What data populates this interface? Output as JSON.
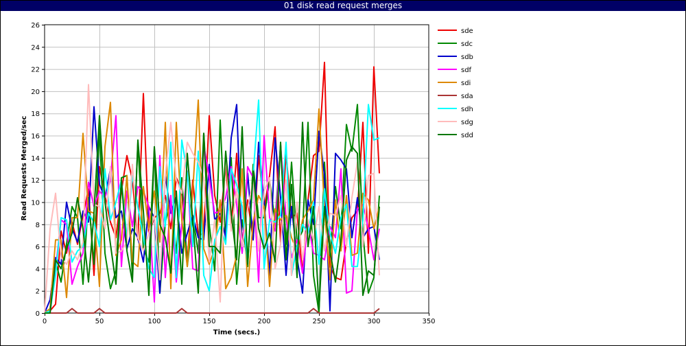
{
  "window": {
    "title": "01 disk read request merges"
  },
  "chart_data": {
    "type": "line",
    "title": "01 disk read request merges",
    "xlabel": "Time (secs.)",
    "ylabel": "Read Requests Merged/sec",
    "xlim": [
      0,
      350
    ],
    "ylim": [
      0,
      26
    ],
    "xticks": [
      0,
      50,
      100,
      150,
      200,
      250,
      300,
      350
    ],
    "yticks": [
      0,
      2,
      4,
      6,
      8,
      10,
      12,
      14,
      16,
      18,
      20,
      22,
      24,
      26
    ],
    "grid": true,
    "legend_position": "right",
    "x": [
      5,
      10,
      15,
      20,
      25,
      30,
      35,
      40,
      45,
      50,
      55,
      60,
      65,
      70,
      75,
      80,
      85,
      90,
      95,
      100,
      105,
      110,
      115,
      120,
      125,
      130,
      135,
      140,
      145,
      150,
      155,
      160,
      165,
      170,
      175,
      180,
      185,
      190,
      195,
      200,
      205,
      210,
      215,
      220,
      225,
      230,
      235,
      240,
      245,
      250,
      255,
      260,
      265,
      270,
      275,
      280,
      285,
      290,
      295,
      300,
      305
    ],
    "series": [
      {
        "name": "sde",
        "color": "#ee0000",
        "values": [
          0.2,
          0.8,
          7.4,
          5.4,
          8.2,
          6.2,
          8.8,
          11.2,
          3.4,
          13.2,
          10.6,
          8.2,
          6.8,
          11.0,
          14.2,
          12.0,
          6.6,
          19.8,
          7.2,
          8.6,
          9.0,
          10.6,
          7.6,
          12.2,
          11.0,
          4.6,
          12.0,
          7.0,
          7.2,
          17.8,
          10.6,
          8.2,
          13.2,
          7.8,
          14.4,
          6.4,
          10.2,
          6.6,
          14.2,
          9.4,
          12.4,
          16.8,
          6.4,
          14.4,
          8.6,
          9.0,
          3.6,
          10.2,
          14.2,
          14.6,
          22.6,
          4.2,
          3.2,
          3.0,
          6.4,
          8.6,
          9.2,
          17.2,
          5.4,
          22.2,
          12.6
        ]
      },
      {
        "name": "sdc",
        "color": "#008800",
        "values": [
          0.4,
          4.6,
          2.8,
          6.2,
          9.6,
          8.6,
          2.6,
          10.4,
          4.4,
          16.6,
          5.4,
          2.2,
          3.8,
          12.2,
          12.4,
          3.4,
          15.4,
          5.8,
          4.6,
          14.8,
          1.8,
          8.2,
          10.2,
          5.4,
          12.2,
          4.2,
          8.8,
          5.4,
          16.2,
          8.0,
          3.8,
          17.4,
          6.4,
          14.0,
          2.6,
          8.4,
          4.2,
          13.4,
          8.6,
          8.6,
          12.0,
          8.2,
          15.2,
          6.2,
          13.6,
          6.4,
          7.4,
          17.2,
          3.4,
          0.0,
          13.6,
          5.2,
          11.4,
          7.6,
          17.0,
          14.6,
          18.8,
          7.2,
          1.8,
          3.2,
          10.6
        ]
      },
      {
        "name": "sdb",
        "color": "#0000cc",
        "values": [
          1.2,
          5.0,
          4.4,
          10.0,
          7.6,
          6.4,
          9.2,
          8.2,
          18.6,
          11.6,
          10.4,
          13.0,
          8.6,
          9.2,
          5.8,
          7.6,
          6.8,
          4.6,
          9.6,
          8.6,
          1.8,
          12.4,
          9.0,
          10.6,
          5.4,
          7.2,
          8.8,
          6.8,
          6.6,
          13.4,
          8.4,
          9.0,
          6.8,
          15.8,
          18.8,
          5.4,
          12.6,
          6.6,
          15.4,
          10.0,
          3.4,
          15.8,
          10.4,
          3.4,
          9.6,
          5.0,
          1.8,
          10.2,
          8.0,
          16.4,
          12.4,
          0.2,
          14.4,
          13.8,
          13.0,
          6.8,
          10.4,
          6.8,
          7.6,
          7.8,
          4.8
        ]
      },
      {
        "name": "sdf",
        "color": "#ff00ff",
        "values": [
          0.0,
          4.0,
          8.4,
          8.0,
          2.6,
          4.2,
          5.4,
          11.8,
          9.6,
          11.0,
          10.4,
          12.0,
          17.8,
          4.2,
          11.0,
          7.8,
          11.4,
          11.0,
          9.6,
          1.0,
          14.2,
          3.2,
          10.6,
          2.8,
          8.0,
          12.8,
          4.0,
          3.8,
          15.2,
          12.2,
          9.0,
          9.2,
          10.4,
          13.2,
          9.8,
          5.4,
          13.2,
          12.2,
          2.8,
          16.0,
          8.6,
          7.4,
          15.2,
          8.6,
          5.0,
          6.6,
          3.6,
          8.2,
          5.4,
          5.2,
          4.8,
          7.8,
          6.8,
          13.0,
          1.8,
          2.0,
          9.4,
          9.8,
          7.6,
          4.8,
          7.6
        ]
      },
      {
        "name": "sdi",
        "color": "#dd8800",
        "values": [
          0.4,
          6.6,
          6.6,
          1.4,
          8.6,
          8.6,
          16.2,
          9.2,
          9.0,
          2.4,
          15.0,
          19.0,
          5.2,
          6.6,
          12.4,
          4.6,
          4.2,
          11.4,
          7.6,
          11.0,
          6.4,
          17.2,
          2.2,
          17.2,
          8.4,
          4.2,
          11.0,
          19.2,
          5.8,
          4.4,
          5.8,
          10.2,
          2.2,
          3.2,
          5.2,
          13.0,
          2.4,
          8.2,
          10.6,
          9.6,
          2.4,
          9.4,
          8.4,
          8.8,
          6.8,
          5.6,
          8.4,
          9.2,
          10.2,
          18.4,
          9.4,
          3.0,
          10.2,
          5.6,
          10.6,
          5.2,
          5.4,
          10.8,
          10.2,
          7.6,
          9.6
        ]
      },
      {
        "name": "sda",
        "color": "#aa3333",
        "values": [
          0.0,
          0.0,
          0.0,
          0.0,
          0.4,
          0.0,
          0.0,
          0.0,
          0.0,
          0.4,
          0.0,
          0.0,
          0.0,
          0.0,
          0.0,
          0.0,
          0.0,
          0.0,
          0.0,
          0.0,
          0.0,
          0.0,
          0.0,
          0.0,
          0.4,
          0.0,
          0.0,
          0.0,
          0.0,
          0.0,
          0.0,
          0.0,
          0.0,
          0.0,
          0.0,
          0.0,
          0.0,
          0.0,
          0.0,
          0.0,
          0.0,
          0.0,
          0.0,
          0.0,
          0.0,
          0.0,
          0.0,
          0.0,
          0.4,
          0.0,
          0.0,
          0.0,
          0.0,
          0.0,
          0.0,
          0.0,
          0.0,
          0.0,
          0.0,
          0.0,
          0.4
        ]
      },
      {
        "name": "sdh",
        "color": "#00ffff",
        "values": [
          0.2,
          3.4,
          8.6,
          8.4,
          4.6,
          5.6,
          6.0,
          9.0,
          8.2,
          6.0,
          13.0,
          8.4,
          10.0,
          12.0,
          6.8,
          12.4,
          9.6,
          6.8,
          4.0,
          3.2,
          13.2,
          7.8,
          15.4,
          3.2,
          15.6,
          12.6,
          6.0,
          14.6,
          3.4,
          2.0,
          6.6,
          7.8,
          6.2,
          13.0,
          11.6,
          9.6,
          4.4,
          12.4,
          19.2,
          4.0,
          8.4,
          8.2,
          8.8,
          15.4,
          3.4,
          6.0,
          8.0,
          7.2,
          10.0,
          4.4,
          11.2,
          7.2,
          5.4,
          8.6,
          9.8,
          4.2,
          4.2,
          8.4,
          18.8,
          15.6,
          15.8
        ]
      },
      {
        "name": "sdg",
        "color": "#ffbbbb",
        "values": [
          7.6,
          10.8,
          5.0,
          4.4,
          5.6,
          4.8,
          6.4,
          20.6,
          9.8,
          9.6,
          7.6,
          13.2,
          5.4,
          5.6,
          6.4,
          13.4,
          6.8,
          5.6,
          7.2,
          8.8,
          3.0,
          12.4,
          17.2,
          12.0,
          10.8,
          15.4,
          14.4,
          13.6,
          12.2,
          4.6,
          8.4,
          1.0,
          14.4,
          7.4,
          11.2,
          6.0,
          9.4,
          12.0,
          5.6,
          11.0,
          12.2,
          4.0,
          6.2,
          12.0,
          3.4,
          10.0,
          4.8,
          8.4,
          6.6,
          9.6,
          5.6,
          9.0,
          8.8,
          10.6,
          6.0,
          10.4,
          13.6,
          6.0,
          12.4,
          12.6,
          3.4
        ]
      },
      {
        "name": "sdd",
        "color": "#007700",
        "values": [
          0.0,
          4.8,
          4.0,
          5.8,
          7.2,
          10.4,
          7.6,
          2.8,
          9.0,
          17.8,
          10.0,
          6.2,
          2.6,
          12.0,
          5.6,
          2.8,
          15.6,
          9.2,
          1.6,
          15.0,
          8.0,
          6.8,
          3.6,
          11.0,
          2.6,
          14.4,
          8.4,
          1.8,
          16.2,
          6.0,
          6.0,
          5.4,
          14.6,
          9.0,
          4.8,
          16.8,
          4.4,
          12.8,
          7.6,
          5.8,
          7.2,
          4.6,
          15.4,
          4.8,
          11.6,
          3.2,
          17.2,
          6.0,
          9.6,
          0.4,
          9.6,
          5.6,
          2.8,
          6.6,
          13.8,
          15.0,
          14.4,
          1.6,
          3.8,
          3.4,
          9.6
        ]
      }
    ]
  }
}
